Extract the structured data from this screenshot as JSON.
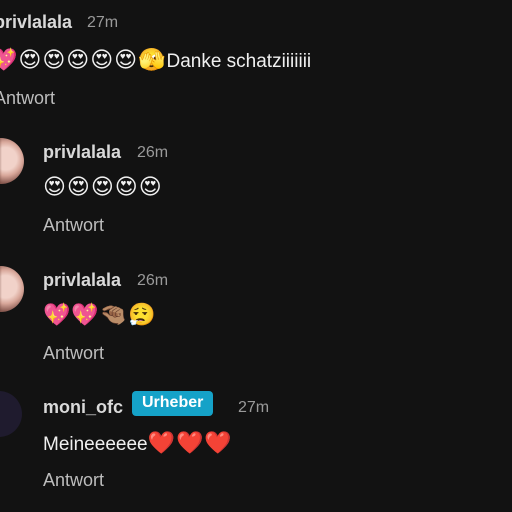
{
  "comments": [
    {
      "username": "privlalala",
      "time": "27m",
      "emojis": "💖😍😍😍😍😍🫣",
      "text": "Danke schatziiiiiii",
      "reply": "Antwort"
    },
    {
      "username": "privlalala",
      "time": "26m",
      "emojis": "😍😍😍😍😍",
      "text": "",
      "reply": "Antwort"
    },
    {
      "username": "privlalala",
      "time": "26m",
      "emojis": "💖💖🤏🏽😮‍💨",
      "text": "",
      "reply": "Antwort"
    },
    {
      "username": "moni_ofc",
      "badge": "Urheber",
      "time": "27m",
      "text": "Meineeeeee",
      "emojis": "❤️❤️❤️",
      "reply": "Antwort"
    }
  ],
  "colors": {
    "background": "#121212",
    "badge": "#15a2c8"
  }
}
